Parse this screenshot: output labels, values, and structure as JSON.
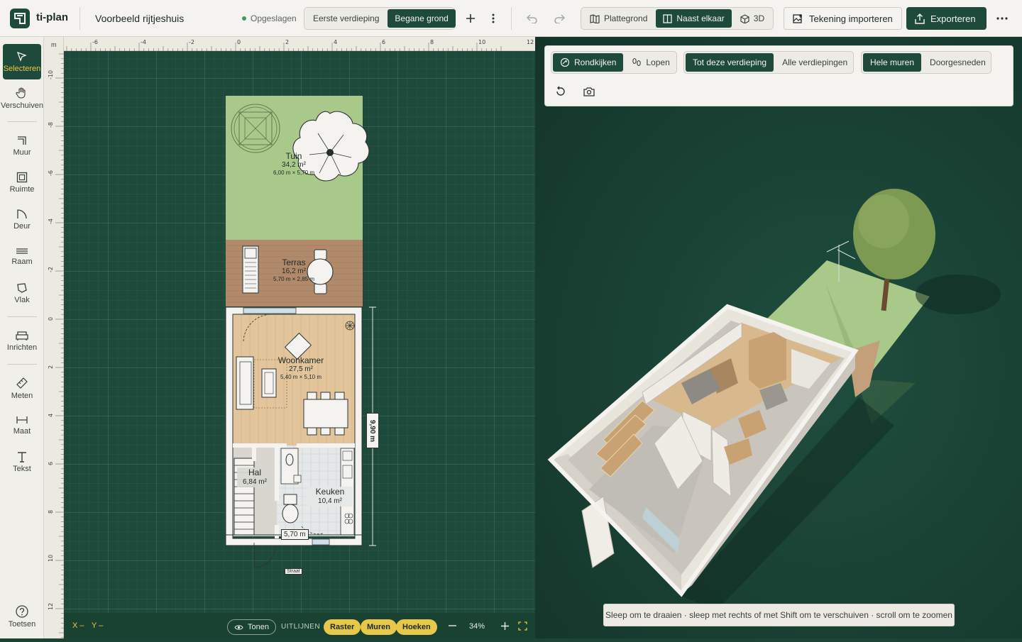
{
  "app": {
    "name": "ti-plan"
  },
  "header": {
    "document_title": "Voorbeeld rijtjeshuis",
    "save_status": "Opgeslagen",
    "floors": [
      "Eerste verdieping",
      "Begane grond"
    ],
    "active_floor": "Begane grond",
    "views": [
      {
        "label": "Plattegrond",
        "icon": "map-icon"
      },
      {
        "label": "Naast elkaar",
        "icon": "split-view-icon"
      },
      {
        "label": "3D",
        "icon": "cube-icon"
      }
    ],
    "active_view": "Naast elkaar",
    "import_label": "Tekening importeren",
    "export_label": "Exporteren"
  },
  "sidebar": {
    "tools": [
      {
        "label": "Selecteren",
        "icon": "cursor-icon",
        "active": true
      },
      {
        "label": "Verschuiven",
        "icon": "hand-icon"
      },
      {
        "label": "Muur",
        "icon": "wall-icon"
      },
      {
        "label": "Ruimte",
        "icon": "room-icon"
      },
      {
        "label": "Deur",
        "icon": "door-icon"
      },
      {
        "label": "Raam",
        "icon": "window-icon"
      },
      {
        "label": "Vlak",
        "icon": "polygon-icon"
      },
      {
        "label": "Inrichten",
        "icon": "sofa-icon"
      },
      {
        "label": "Meten",
        "icon": "ruler-icon"
      },
      {
        "label": "Maat",
        "icon": "dimension-icon"
      },
      {
        "label": "Tekst",
        "icon": "text-icon"
      }
    ],
    "help_label": "Toetsen"
  },
  "ruler": {
    "unit": "m",
    "horizontal_ticks": [
      "-6",
      "-4",
      "-2",
      "0",
      "2",
      "4",
      "6",
      "8",
      "10",
      "12"
    ],
    "vertical_ticks": [
      "-10",
      "-8",
      "-6",
      "-4",
      "-2",
      "0",
      "2",
      "4",
      "6",
      "8",
      "10",
      "12"
    ]
  },
  "plan": {
    "rooms": [
      {
        "name": "Tuin",
        "area": "34,2 m²",
        "dims": "6,00 m × 5,70 m"
      },
      {
        "name": "Terras",
        "area": "16,2 m²",
        "dims": "5,70 m × 2,85 m"
      },
      {
        "name": "Woonkamer",
        "area": "27,5 m²",
        "dims": "5,40 m × 5,10 m"
      },
      {
        "name": "Hal",
        "area": "6,84 m²"
      },
      {
        "name": "Keuken",
        "area": "10,4 m²"
      }
    ],
    "dimension_width": "5,70 m",
    "dimension_depth": "9,90 m",
    "street_label": "Straat"
  },
  "status": {
    "x_label": "X",
    "x_value": "–",
    "y_label": "Y",
    "y_value": "–",
    "show_label": "Tonen",
    "align_label": "UITLIJNEN",
    "snap_options": [
      "Raster",
      "Muren",
      "Hoeken"
    ],
    "zoom": "34%"
  },
  "view3d": {
    "camera_modes": [
      "Rondkijken",
      "Lopen"
    ],
    "active_camera": "Rondkijken",
    "floor_modes": [
      "Tot deze verdieping",
      "Alle verdiepingen"
    ],
    "active_floor_mode": "Tot deze verdieping",
    "wall_modes": [
      "Hele muren",
      "Doorgesneden"
    ],
    "active_wall_mode": "Hele muren",
    "hint": "Sleep om te draaien · sleep met rechts of met Shift om te verschuiven · scroll om te zoomen"
  },
  "colors": {
    "brand": "#1d4a3a",
    "accent": "#e8c848",
    "canvas": "#1e4a3b",
    "garden": "#a9c98a",
    "terrace": "#b08a6a",
    "wood_floor": "#e2c59b"
  }
}
